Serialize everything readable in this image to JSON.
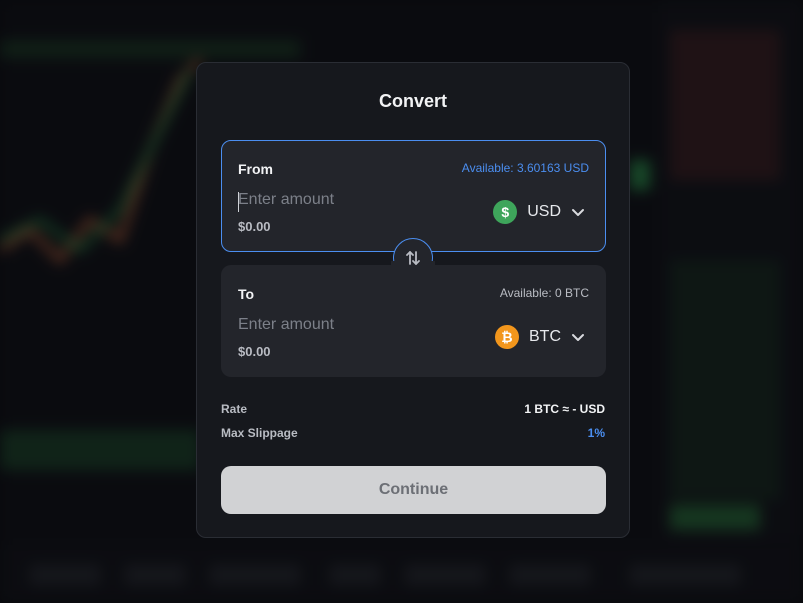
{
  "modal": {
    "title": "Convert",
    "from": {
      "label": "From",
      "available": "Available: 3.60163 USD",
      "placeholder": "Enter amount",
      "fiat_value": "$0.00",
      "asset_code": "USD",
      "asset_icon": "usd-coin-icon",
      "asset_symbol": "$",
      "asset_color": "#3ea55b"
    },
    "to": {
      "label": "To",
      "available": "Available: 0 BTC",
      "placeholder": "Enter amount",
      "fiat_value": "$0.00",
      "asset_code": "BTC",
      "asset_icon": "btc-coin-icon",
      "asset_symbol": "₿",
      "asset_color": "#f2961c"
    },
    "rate": {
      "label": "Rate",
      "value": "1 BTC ≈ - USD"
    },
    "slippage": {
      "label": "Max Slippage",
      "value": "1%"
    },
    "continue_label": "Continue"
  },
  "colors": {
    "accent": "#4b8ef0",
    "card_bg": "#23252b",
    "modal_bg": "#16181d",
    "button_bg": "#d1d2d4"
  }
}
